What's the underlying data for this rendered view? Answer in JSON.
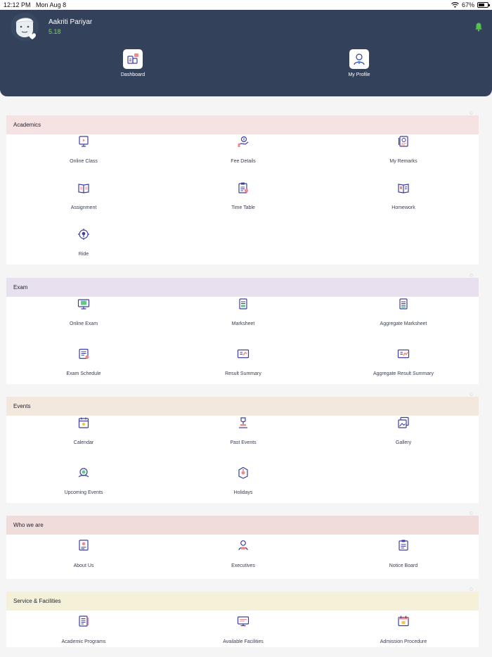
{
  "status_bar": {
    "time": "12:12 PM",
    "date": "Mon Aug 8",
    "battery": "67%",
    "battery_level": 0.67
  },
  "user": {
    "name": "Aakriti Pariyar",
    "class": "5.18"
  },
  "quick_actions": [
    {
      "label": "Dashboard",
      "icon": "dashboard-icon"
    },
    {
      "label": "My Profile",
      "icon": "profile-icon"
    }
  ],
  "sections": [
    {
      "title": "Academics",
      "color": "#f5e2e2",
      "items": [
        {
          "label": "Online Class",
          "icon": "online-class-icon"
        },
        {
          "label": "Fee Details",
          "icon": "fee-details-icon"
        },
        {
          "label": "My Remarks",
          "icon": "remarks-icon"
        },
        {
          "label": "Assignment",
          "icon": "assignment-icon"
        },
        {
          "label": "Time Table",
          "icon": "time-table-icon"
        },
        {
          "label": "Homework",
          "icon": "homework-icon"
        },
        {
          "label": "Ride",
          "icon": "ride-icon"
        }
      ]
    },
    {
      "title": "Exam",
      "color": "#e8e0ef",
      "items": [
        {
          "label": "Online Exam",
          "icon": "online-exam-icon"
        },
        {
          "label": "Marksheet",
          "icon": "marksheet-icon"
        },
        {
          "label": "Aggregate Marksheet",
          "icon": "aggregate-marksheet-icon"
        },
        {
          "label": "Exam Schedule",
          "icon": "exam-schedule-icon"
        },
        {
          "label": "Result Summary",
          "icon": "result-summary-icon"
        },
        {
          "label": "Aggregate Result Summary",
          "icon": "aggregate-result-icon"
        }
      ]
    },
    {
      "title": "Events",
      "color": "#f2e8de",
      "items": [
        {
          "label": "Calendar",
          "icon": "calendar-icon"
        },
        {
          "label": "Past Events",
          "icon": "past-events-icon"
        },
        {
          "label": "Gallery",
          "icon": "gallery-icon"
        },
        {
          "label": "Upcoming Events",
          "icon": "upcoming-events-icon"
        },
        {
          "label": "Holidays",
          "icon": "holidays-icon"
        }
      ]
    },
    {
      "title": "Who we are",
      "color": "#f0dcda",
      "items": [
        {
          "label": "About Us",
          "icon": "about-us-icon"
        },
        {
          "label": "Executives",
          "icon": "executives-icon"
        },
        {
          "label": "Notice Board",
          "icon": "notice-board-icon"
        }
      ]
    },
    {
      "title": "Service & Facilities",
      "color": "#f5f1d8",
      "items": [
        {
          "label": "Academic Programs",
          "icon": "academic-programs-icon"
        },
        {
          "label": "Available Facilities",
          "icon": "available-facilities-icon"
        },
        {
          "label": "Admission Procedure",
          "icon": "admission-procedure-icon"
        }
      ]
    }
  ],
  "colors": {
    "header": "#33425a",
    "icon_primary": "#3f3d9e",
    "icon_accent": "#f08a8a",
    "name_accent": "#7bd36a"
  }
}
